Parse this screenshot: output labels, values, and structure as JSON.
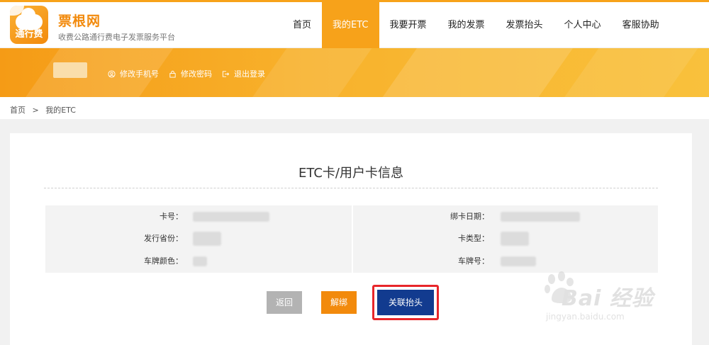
{
  "brand": {
    "name": "票根网",
    "slogan": "收费公路通行费电子发票服务平台",
    "icon_text": "通行费",
    "icon": "cloud-logo-icon"
  },
  "nav": {
    "items": [
      {
        "label": "首页"
      },
      {
        "label": "我的ETC",
        "active": true
      },
      {
        "label": "我要开票"
      },
      {
        "label": "我的发票"
      },
      {
        "label": "发票抬头"
      },
      {
        "label": "个人中心"
      },
      {
        "label": "客服协助"
      }
    ]
  },
  "banner": {
    "change_phone": "修改手机号",
    "change_password": "修改密码",
    "logout": "退出登录"
  },
  "breadcrumb": {
    "home": "首页",
    "separator": ">",
    "current": "我的ETC"
  },
  "card": {
    "title": "ETC卡/用户卡信息",
    "left_rows": [
      {
        "label": "卡号："
      },
      {
        "label": "发行省份："
      },
      {
        "label": "车牌颜色："
      }
    ],
    "right_rows": [
      {
        "label": "绑卡日期："
      },
      {
        "label": "卡类型："
      },
      {
        "label": "车牌号："
      }
    ]
  },
  "buttons": {
    "back": "返回",
    "unbind": "解绑",
    "link_title": "关联抬头"
  },
  "watermark": {
    "text": "Bai  经验",
    "sub": "jingyan.baidu.com"
  },
  "colors": {
    "accent": "#f7a21a",
    "primary_button": "#123b8f",
    "highlight_border": "#e8262a"
  }
}
